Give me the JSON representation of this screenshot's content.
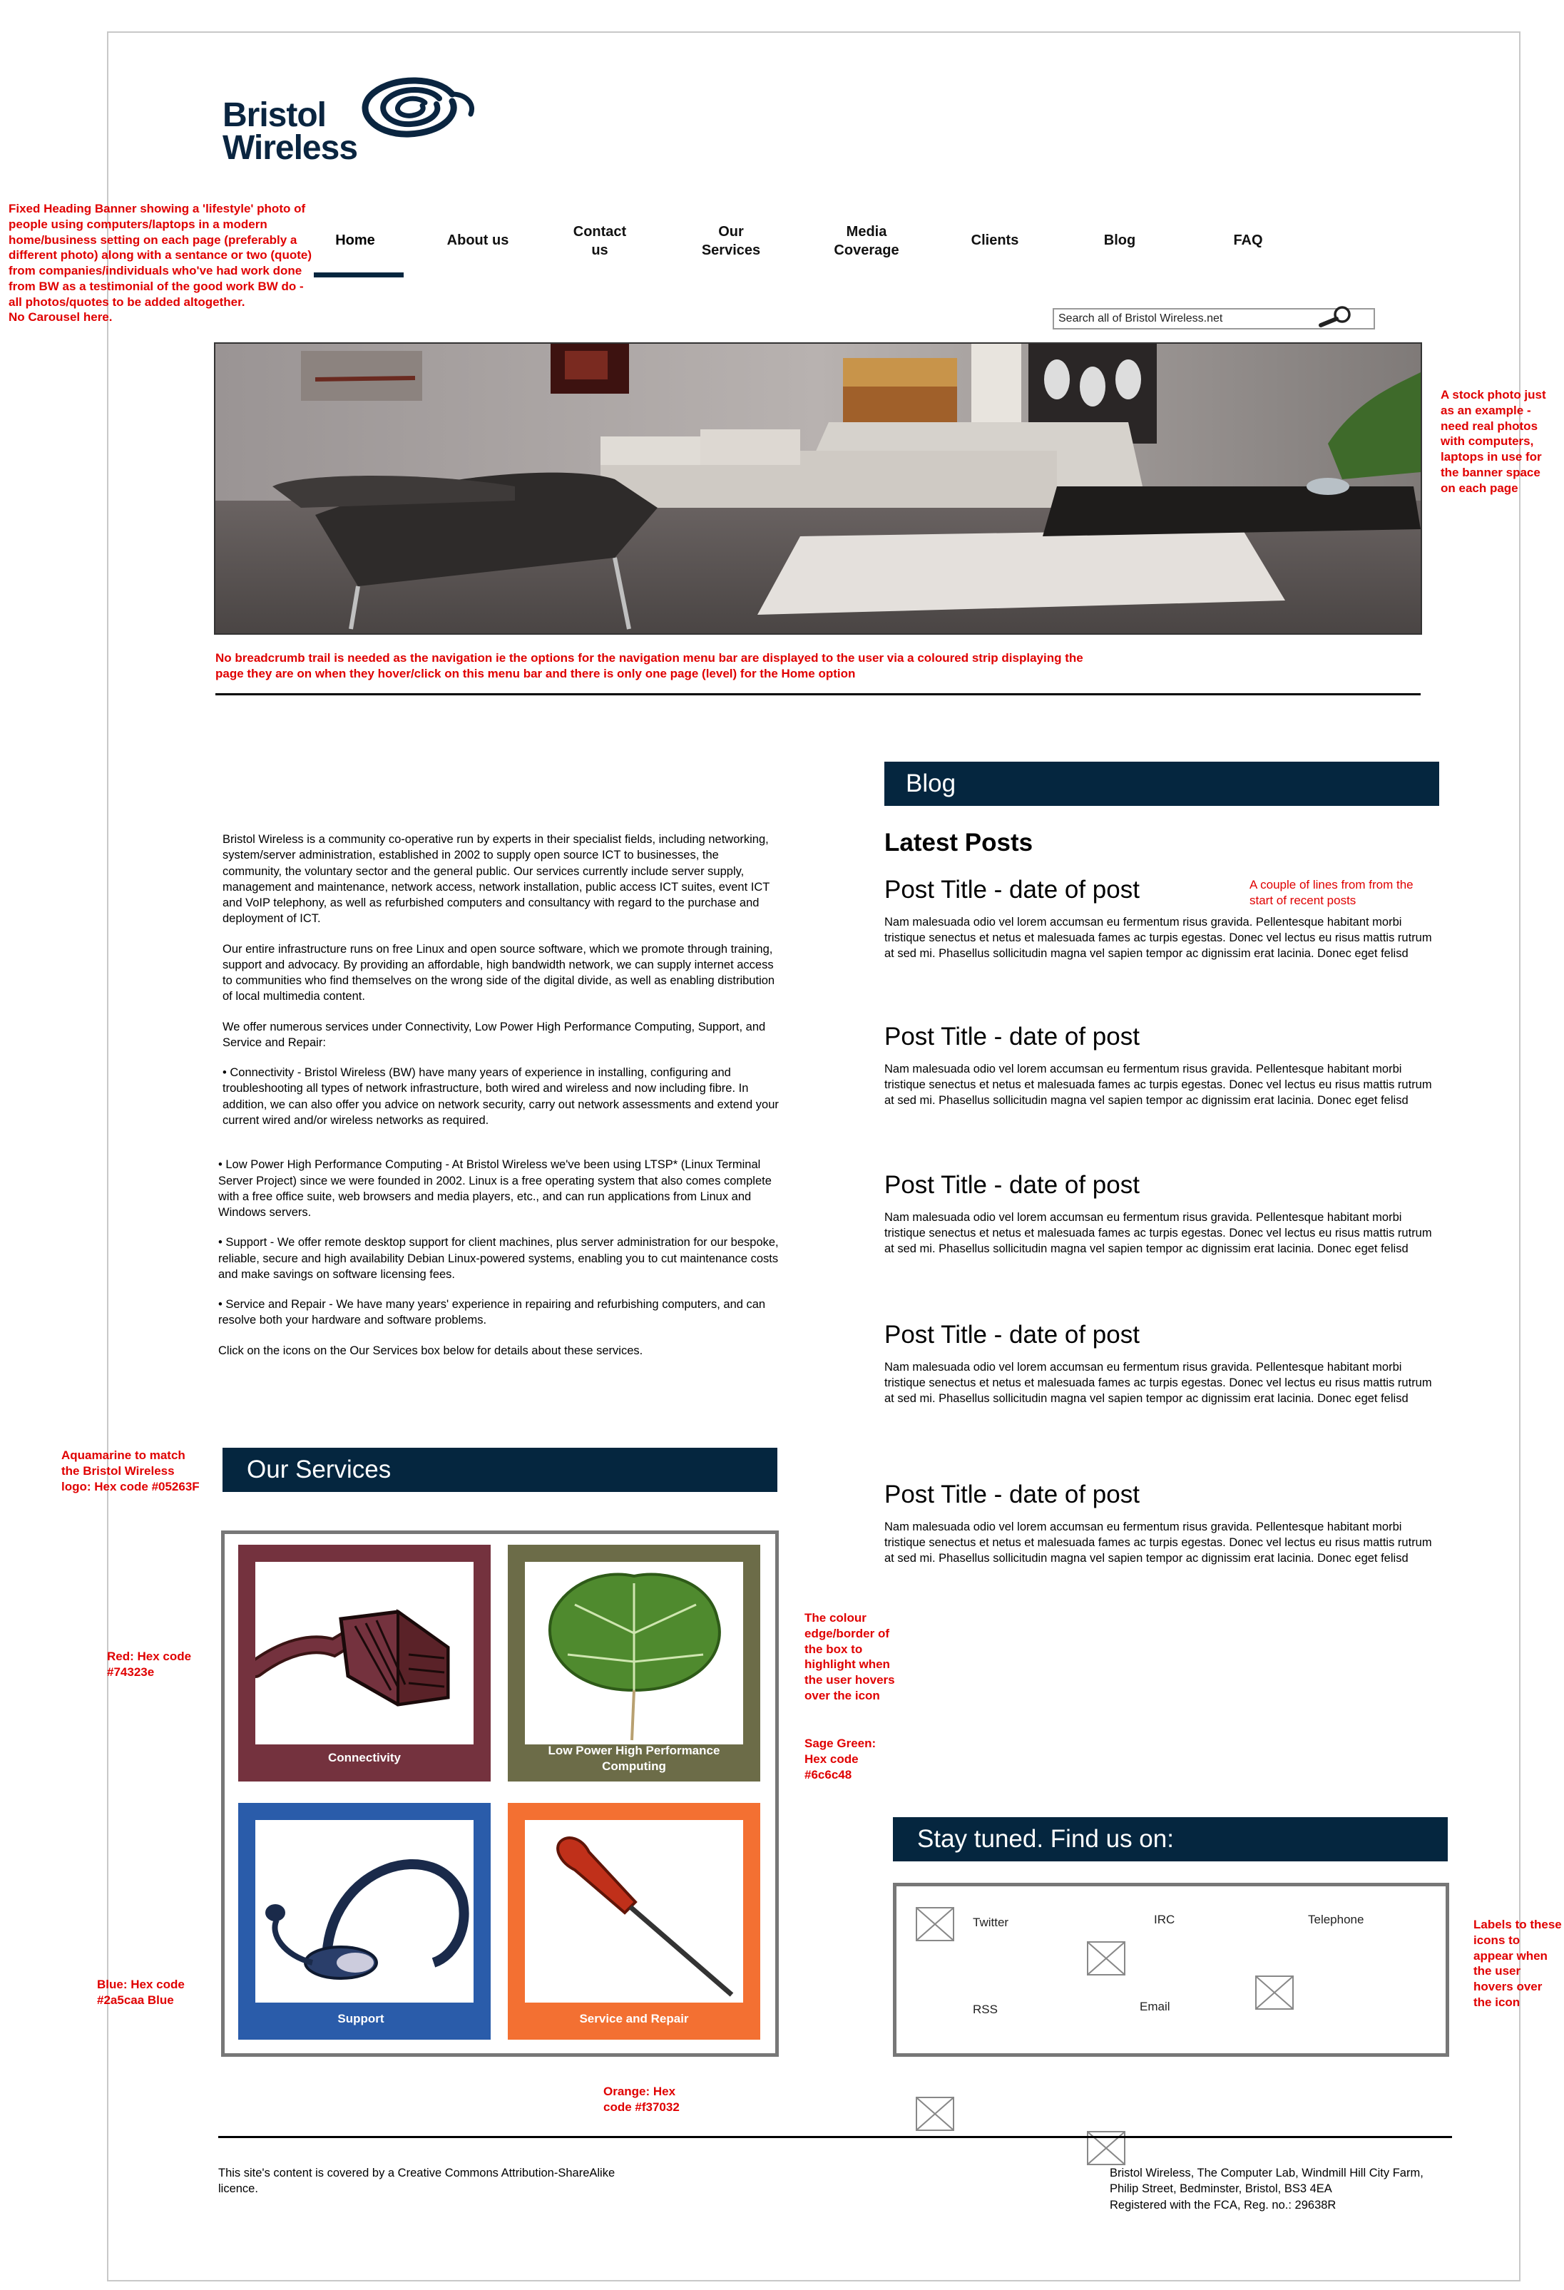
{
  "logo": {
    "line1": "Bristol",
    "line2": "Wireless"
  },
  "nav": [
    {
      "label": "Home"
    },
    {
      "label": "About us"
    },
    {
      "label": "Contact\nus"
    },
    {
      "label": "Our\nServices"
    },
    {
      "label": "Media\nCoverage"
    },
    {
      "label": "Clients"
    },
    {
      "label": "Blog"
    },
    {
      "label": "FAQ"
    }
  ],
  "search": {
    "placeholder": "Search  all of Bristol Wireless.net"
  },
  "annotations": {
    "banner_note": "Fixed Heading Banner showing a 'lifestyle' photo of people using computers/laptops in a modern home/business setting on each page (preferably a different photo) along  with a sentance or two (quote) from companies/individuals who've had work done from BW as a testimonial of the good work BW do - all photos/quotes to be added altogether.\nNo Carousel here.",
    "stock_photo": "A stock photo just as an example - need real photos with computers, laptops in use for the banner space on each page",
    "breadcrumb_note": "No breadcrumb trail is needed as the navigation ie the options for the navigation menu bar are displayed to the user via a coloured strip displaying the page they are on when they hover/click on this menu bar and there is only one page (level) for the Home option",
    "recent_posts": "A couple of lines from from the start of recent posts",
    "aquamarine": "Aquamarine to match the Bristol Wireless logo: Hex code #05263F",
    "red": "Red: Hex code #74323e",
    "blue": "Blue: Hex code #2a5caa Blue",
    "colour_edge": "The colour edge/border of the box to highlight when the user hovers over the icon",
    "sage": "Sage Green: Hex code #6c6c48",
    "orange": "Orange: Hex code #f37032",
    "labels_icons": "Labels to these icons to appear when the user hovers over the icon"
  },
  "intro": {
    "p1": "Bristol Wireless is a community co-operative run by experts in their specialist fields, including networking, system/server administration, established in 2002 to supply open source ICT to businesses, the community, the voluntary sector and the general public. Our services currently include server supply, management and maintenance, network access, network installation, public access ICT suites, event ICT and VoIP telephony, as well as refurbished computers and consultancy with regard to the purchase and deployment of ICT.",
    "p2": "Our entire infrastructure runs on free Linux and open source software, which we promote through training, support and advocacy. By providing an affordable, high bandwidth network, we can supply internet access to communities who find themselves on the wrong side of the digital divide, as well as enabling distribution of local multimedia content.",
    "p3": "We offer numerous services under Connectivity, Low Power High Performance Computing, Support, and Service and Repair:",
    "p4": "•  Connectivity - Bristol Wireless (BW) have many years of experience in installing, configuring and troubleshooting all types of network infrastructure, both wired and wireless and now including fibre. In addition, we can also offer you advice on network security, carry out network assessments and extend your current wired and/or wireless networks as required.",
    "p5": "•  Low Power High Performance Computing - At Bristol Wireless we've been using LTSP* (Linux Terminal Server Project) since we were founded in 2002. Linux is a free operating system that also comes complete with a free office suite, web browsers and media players, etc., and can run applications from Linux and Windows servers.",
    "p6": "•  Support - We offer remote desktop support for client machines, plus server administration for our bespoke, reliable, secure and high availability Debian Linux-powered systems, enabling you to cut maintenance costs and make savings on software licensing fees.",
    "p7": "•  Service and Repair - We have many years' experience in repairing and refurbishing computers, and can resolve both your hardware and software problems.",
    "p8": "Click on the icons on the Our Services box below for details about these services."
  },
  "blog": {
    "heading": "Blog",
    "latest": "Latest Posts",
    "posts": [
      {
        "title": "Post Title - date of post",
        "body": "Nam malesuada odio vel lorem accumsan eu fermentum risus gravida. Pellentesque habitant morbi tristique senectus et netus et malesuada fames ac turpis egestas. Donec vel lectus eu risus mattis rutrum at sed mi. Phasellus sollicitudin magna vel sapien tempor ac dignissim erat lacinia. Donec eget felisd"
      },
      {
        "title": "Post Title - date of post",
        "body": "Nam malesuada odio vel lorem accumsan eu fermentum risus gravida. Pellentesque habitant morbi tristique senectus et netus et malesuada fames ac turpis egestas. Donec vel lectus eu risus mattis rutrum at sed mi. Phasellus sollicitudin magna vel sapien tempor ac dignissim erat lacinia. Donec eget felisd"
      },
      {
        "title": "Post Title - date of post",
        "body": "Nam malesuada odio vel lorem accumsan eu fermentum risus gravida. Pellentesque habitant morbi tristique senectus et netus et malesuada fames ac turpis egestas. Donec vel lectus eu risus mattis rutrum at sed mi. Phasellus sollicitudin magna vel sapien tempor ac dignissim erat lacinia. Donec eget felisd"
      },
      {
        "title": "Post Title - date of post",
        "body": "Nam malesuada odio vel lorem accumsan eu fermentum risus gravida. Pellentesque habitant morbi tristique senectus et netus et malesuada fames ac turpis egestas. Donec vel lectus eu risus mattis rutrum at sed mi. Phasellus sollicitudin magna vel sapien tempor ac dignissim erat lacinia. Donec eget felisd"
      },
      {
        "title": "Post Title - date of post",
        "body": "Nam malesuada odio vel lorem accumsan eu fermentum risus gravida. Pellentesque habitant morbi tristique senectus et netus et malesuada fames ac turpis egestas. Donec vel lectus eu risus mattis rutrum at sed mi. Phasellus sollicitudin magna vel sapien tempor ac dignissim erat lacinia. Donec eget felisd"
      }
    ]
  },
  "services": {
    "heading": "Our Services",
    "items": [
      {
        "label": "Connectivity",
        "color": "#74323e",
        "icon": "network-cable-icon"
      },
      {
        "label": "Low Power High Performance\nComputing",
        "color": "#6c6c48",
        "icon": "leaf-icon"
      },
      {
        "label": "Support",
        "color": "#2a5caa",
        "icon": "headset-icon"
      },
      {
        "label": "Service and Repair",
        "color": "#f37032",
        "icon": "screwdriver-icon"
      }
    ]
  },
  "social": {
    "heading": "Stay tuned. Find us on:",
    "items": [
      {
        "label": "Twitter"
      },
      {
        "label": "IRC"
      },
      {
        "label": "Telephone"
      },
      {
        "label": "RSS"
      },
      {
        "label": "Email"
      }
    ]
  },
  "footer": {
    "license": "This site's content is covered by a Creative Commons Attribution-ShareAlike licence.",
    "address": "Bristol Wireless, The Computer Lab, Windmill Hill City Farm, Philip Street, Bedminster, Bristol, BS3 4EA\nRegistered with the FCA, Reg. no.: 29638R"
  },
  "colors": {
    "aquamarine": "#05263f",
    "red": "#74323e",
    "sage": "#6c6c48",
    "blue": "#2a5caa",
    "orange": "#f37032",
    "annotation": "#e00000"
  }
}
